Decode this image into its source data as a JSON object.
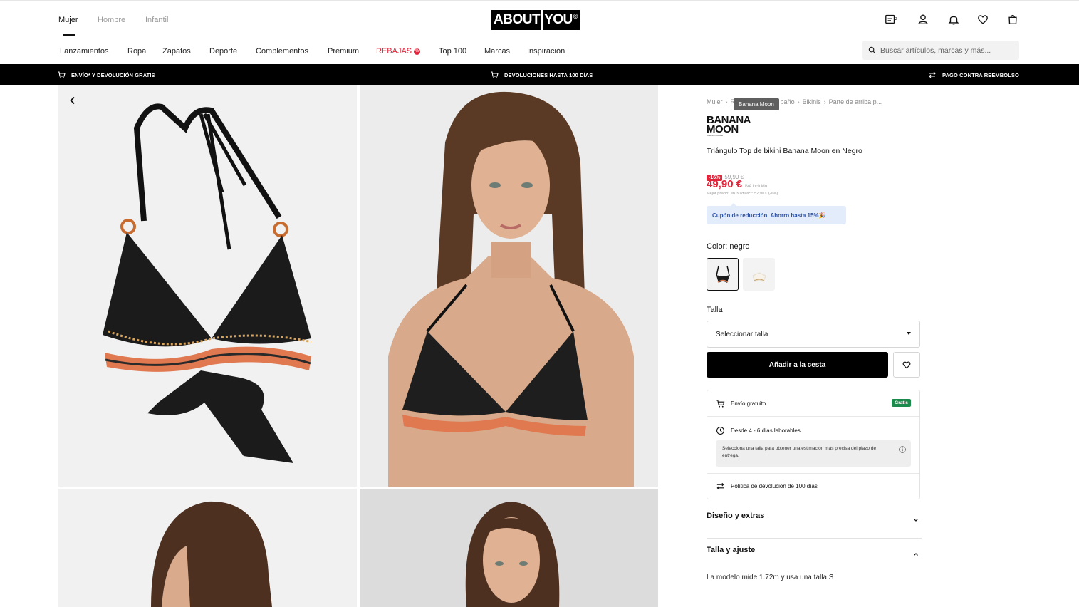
{
  "header": {
    "genders": [
      "Mujer",
      "Hombre",
      "Infantil"
    ],
    "active_gender": "Mujer",
    "logo_left": "ABOUT",
    "logo_right": "YOU",
    "logo_mark": "©",
    "icons": [
      "calendar-badge-icon",
      "user-icon",
      "bell-icon",
      "heart-icon",
      "bag-icon"
    ]
  },
  "nav": {
    "items": [
      "Lanzamientos",
      "Ropa",
      "Zapatos",
      "Deporte",
      "Complementos",
      "Premium",
      "REBAJAS",
      "Top 100",
      "Marcas",
      "Inspiración"
    ],
    "sale_badge": "%",
    "search_placeholder": "Buscar artículos, marcas y más..."
  },
  "promo": {
    "left": "ENVÍO* Y DEVOLUCIÓN GRATIS",
    "center": "DEVOLUCIONES HASTA 100 DÍAS",
    "right": "PAGO CONTRA REEMBOLSO"
  },
  "breadcrumb": [
    "Mujer",
    "Ropa",
    "Moda de baño",
    "Bikinis",
    "Parte de arriba p..."
  ],
  "tooltip": "Banana Moon",
  "product": {
    "brand_line1": "BANANA",
    "brand_line2": "MOON",
    "brand_sub": "collection océane",
    "title": "Triángulo Top de bikini Banana Moon en Negro",
    "discount": "-16%",
    "old_price": "59,90 €",
    "price": "49,90 €",
    "vat": "IVA incluido",
    "best_price": "Mejor precio* en 30 días**: 52,90 € (-6%)",
    "coupon": "Cupón de reducción. Ahorro hasta 15%🎉",
    "color_label": "Color: negro",
    "size_label": "Talla",
    "size_placeholder": "Seleccionar talla",
    "add_to_cart": "Añadir a la cesta"
  },
  "delivery": {
    "shipping": "Envío gratuito",
    "shipping_badge": "Gratis",
    "eta": "Desde 4 - 6 días laborables",
    "eta_info": "Selecciona una talla para obtener una estimación más precisa del plazo de entrega.",
    "returns": "Política de devolución de 100 días"
  },
  "accordion": {
    "design": "Diseño y extras",
    "fit": "Talla y ajuste",
    "fit_body": "La modelo mide 1.72m y usa una talla S"
  },
  "colors": {
    "sale_red": "#e1253a",
    "badge_green": "#1c8a4a",
    "coupon_bg": "#e3ecfb",
    "coupon_text": "#2d52a8"
  }
}
